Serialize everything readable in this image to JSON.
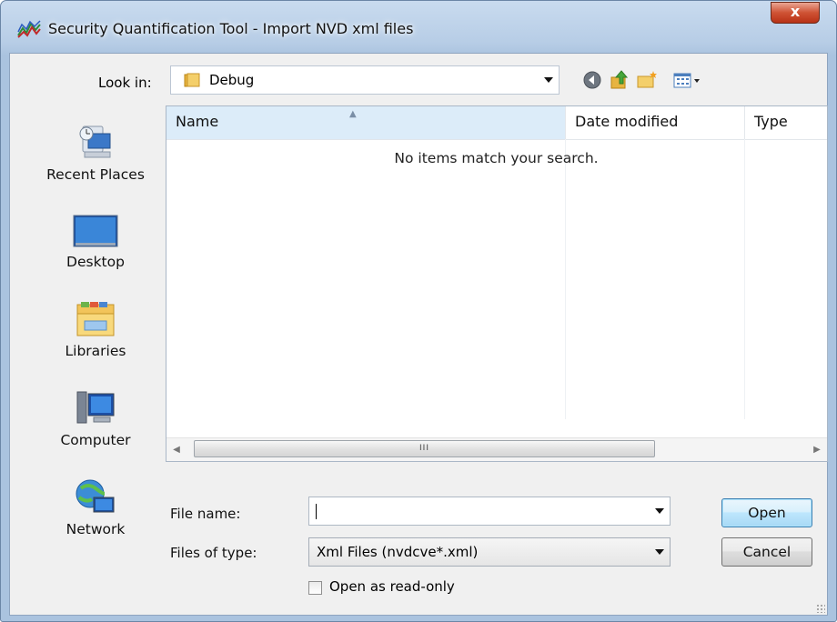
{
  "window": {
    "title": "Security Quantification Tool - Import NVD xml files",
    "close_label": "x"
  },
  "look_in": {
    "label": "Look in:",
    "value": "Debug"
  },
  "toolbar": {
    "icons": [
      "back-icon",
      "up-folder-icon",
      "new-folder-icon",
      "view-menu-icon"
    ]
  },
  "places": [
    {
      "label": "Recent Places",
      "icon": "recent-places-icon"
    },
    {
      "label": "Desktop",
      "icon": "desktop-icon"
    },
    {
      "label": "Libraries",
      "icon": "libraries-icon"
    },
    {
      "label": "Computer",
      "icon": "computer-icon"
    },
    {
      "label": "Network",
      "icon": "network-icon"
    }
  ],
  "file_list": {
    "columns": [
      "Name",
      "Date modified",
      "Type"
    ],
    "empty_message": "No items match your search.",
    "scroll_thumb_label": "III"
  },
  "file_name": {
    "label": "File name:",
    "value": ""
  },
  "file_type": {
    "label": "Files of type:",
    "value": "Xml Files (nvdcve*.xml)"
  },
  "read_only": {
    "label": "Open as read-only",
    "checked": false
  },
  "buttons": {
    "open": "Open",
    "cancel": "Cancel"
  },
  "colors": {
    "title_gradient": "#b7cde6",
    "close_button": "#cf5234",
    "header_highlight": "#dcecf9",
    "default_button": "#bee6fd"
  }
}
